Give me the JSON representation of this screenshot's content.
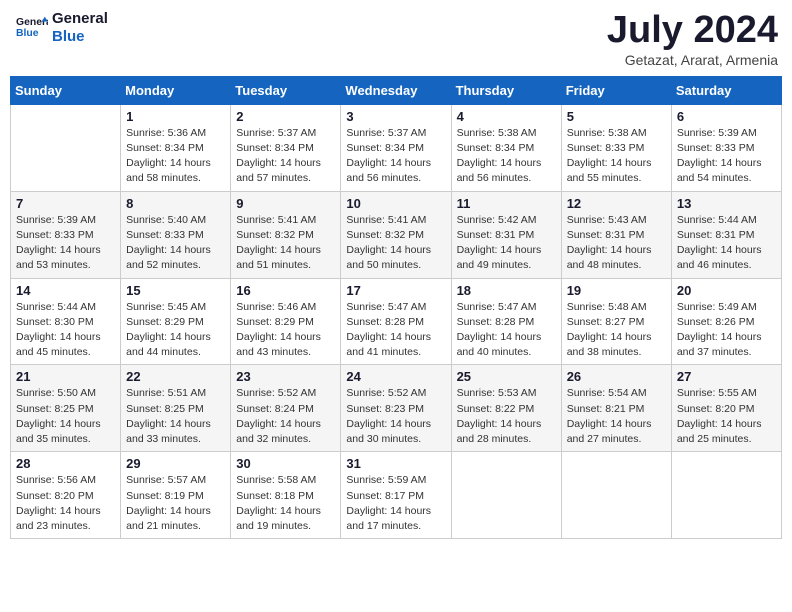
{
  "header": {
    "logo_line1": "General",
    "logo_line2": "Blue",
    "month_title": "July 2024",
    "location": "Getazat, Ararat, Armenia"
  },
  "days_of_week": [
    "Sunday",
    "Monday",
    "Tuesday",
    "Wednesday",
    "Thursday",
    "Friday",
    "Saturday"
  ],
  "weeks": [
    [
      {
        "day": "",
        "sunrise": "",
        "sunset": "",
        "daylight": ""
      },
      {
        "day": "1",
        "sunrise": "Sunrise: 5:36 AM",
        "sunset": "Sunset: 8:34 PM",
        "daylight": "Daylight: 14 hours and 58 minutes."
      },
      {
        "day": "2",
        "sunrise": "Sunrise: 5:37 AM",
        "sunset": "Sunset: 8:34 PM",
        "daylight": "Daylight: 14 hours and 57 minutes."
      },
      {
        "day": "3",
        "sunrise": "Sunrise: 5:37 AM",
        "sunset": "Sunset: 8:34 PM",
        "daylight": "Daylight: 14 hours and 56 minutes."
      },
      {
        "day": "4",
        "sunrise": "Sunrise: 5:38 AM",
        "sunset": "Sunset: 8:34 PM",
        "daylight": "Daylight: 14 hours and 56 minutes."
      },
      {
        "day": "5",
        "sunrise": "Sunrise: 5:38 AM",
        "sunset": "Sunset: 8:33 PM",
        "daylight": "Daylight: 14 hours and 55 minutes."
      },
      {
        "day": "6",
        "sunrise": "Sunrise: 5:39 AM",
        "sunset": "Sunset: 8:33 PM",
        "daylight": "Daylight: 14 hours and 54 minutes."
      }
    ],
    [
      {
        "day": "7",
        "sunrise": "Sunrise: 5:39 AM",
        "sunset": "Sunset: 8:33 PM",
        "daylight": "Daylight: 14 hours and 53 minutes."
      },
      {
        "day": "8",
        "sunrise": "Sunrise: 5:40 AM",
        "sunset": "Sunset: 8:33 PM",
        "daylight": "Daylight: 14 hours and 52 minutes."
      },
      {
        "day": "9",
        "sunrise": "Sunrise: 5:41 AM",
        "sunset": "Sunset: 8:32 PM",
        "daylight": "Daylight: 14 hours and 51 minutes."
      },
      {
        "day": "10",
        "sunrise": "Sunrise: 5:41 AM",
        "sunset": "Sunset: 8:32 PM",
        "daylight": "Daylight: 14 hours and 50 minutes."
      },
      {
        "day": "11",
        "sunrise": "Sunrise: 5:42 AM",
        "sunset": "Sunset: 8:31 PM",
        "daylight": "Daylight: 14 hours and 49 minutes."
      },
      {
        "day": "12",
        "sunrise": "Sunrise: 5:43 AM",
        "sunset": "Sunset: 8:31 PM",
        "daylight": "Daylight: 14 hours and 48 minutes."
      },
      {
        "day": "13",
        "sunrise": "Sunrise: 5:44 AM",
        "sunset": "Sunset: 8:31 PM",
        "daylight": "Daylight: 14 hours and 46 minutes."
      }
    ],
    [
      {
        "day": "14",
        "sunrise": "Sunrise: 5:44 AM",
        "sunset": "Sunset: 8:30 PM",
        "daylight": "Daylight: 14 hours and 45 minutes."
      },
      {
        "day": "15",
        "sunrise": "Sunrise: 5:45 AM",
        "sunset": "Sunset: 8:29 PM",
        "daylight": "Daylight: 14 hours and 44 minutes."
      },
      {
        "day": "16",
        "sunrise": "Sunrise: 5:46 AM",
        "sunset": "Sunset: 8:29 PM",
        "daylight": "Daylight: 14 hours and 43 minutes."
      },
      {
        "day": "17",
        "sunrise": "Sunrise: 5:47 AM",
        "sunset": "Sunset: 8:28 PM",
        "daylight": "Daylight: 14 hours and 41 minutes."
      },
      {
        "day": "18",
        "sunrise": "Sunrise: 5:47 AM",
        "sunset": "Sunset: 8:28 PM",
        "daylight": "Daylight: 14 hours and 40 minutes."
      },
      {
        "day": "19",
        "sunrise": "Sunrise: 5:48 AM",
        "sunset": "Sunset: 8:27 PM",
        "daylight": "Daylight: 14 hours and 38 minutes."
      },
      {
        "day": "20",
        "sunrise": "Sunrise: 5:49 AM",
        "sunset": "Sunset: 8:26 PM",
        "daylight": "Daylight: 14 hours and 37 minutes."
      }
    ],
    [
      {
        "day": "21",
        "sunrise": "Sunrise: 5:50 AM",
        "sunset": "Sunset: 8:25 PM",
        "daylight": "Daylight: 14 hours and 35 minutes."
      },
      {
        "day": "22",
        "sunrise": "Sunrise: 5:51 AM",
        "sunset": "Sunset: 8:25 PM",
        "daylight": "Daylight: 14 hours and 33 minutes."
      },
      {
        "day": "23",
        "sunrise": "Sunrise: 5:52 AM",
        "sunset": "Sunset: 8:24 PM",
        "daylight": "Daylight: 14 hours and 32 minutes."
      },
      {
        "day": "24",
        "sunrise": "Sunrise: 5:52 AM",
        "sunset": "Sunset: 8:23 PM",
        "daylight": "Daylight: 14 hours and 30 minutes."
      },
      {
        "day": "25",
        "sunrise": "Sunrise: 5:53 AM",
        "sunset": "Sunset: 8:22 PM",
        "daylight": "Daylight: 14 hours and 28 minutes."
      },
      {
        "day": "26",
        "sunrise": "Sunrise: 5:54 AM",
        "sunset": "Sunset: 8:21 PM",
        "daylight": "Daylight: 14 hours and 27 minutes."
      },
      {
        "day": "27",
        "sunrise": "Sunrise: 5:55 AM",
        "sunset": "Sunset: 8:20 PM",
        "daylight": "Daylight: 14 hours and 25 minutes."
      }
    ],
    [
      {
        "day": "28",
        "sunrise": "Sunrise: 5:56 AM",
        "sunset": "Sunset: 8:20 PM",
        "daylight": "Daylight: 14 hours and 23 minutes."
      },
      {
        "day": "29",
        "sunrise": "Sunrise: 5:57 AM",
        "sunset": "Sunset: 8:19 PM",
        "daylight": "Daylight: 14 hours and 21 minutes."
      },
      {
        "day": "30",
        "sunrise": "Sunrise: 5:58 AM",
        "sunset": "Sunset: 8:18 PM",
        "daylight": "Daylight: 14 hours and 19 minutes."
      },
      {
        "day": "31",
        "sunrise": "Sunrise: 5:59 AM",
        "sunset": "Sunset: 8:17 PM",
        "daylight": "Daylight: 14 hours and 17 minutes."
      },
      {
        "day": "",
        "sunrise": "",
        "sunset": "",
        "daylight": ""
      },
      {
        "day": "",
        "sunrise": "",
        "sunset": "",
        "daylight": ""
      },
      {
        "day": "",
        "sunrise": "",
        "sunset": "",
        "daylight": ""
      }
    ]
  ]
}
